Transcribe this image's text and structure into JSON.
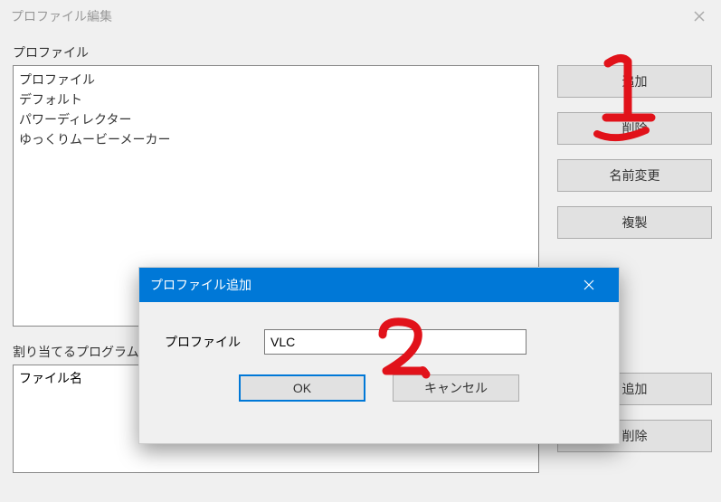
{
  "window": {
    "title": "プロファイル編集"
  },
  "profiles": {
    "label": "プロファイル",
    "items": [
      "プロファイル",
      "デフォルト",
      "パワーディレクター",
      "ゆっくりムービーメーカー"
    ],
    "buttons": {
      "add": "追加",
      "remove": "削除",
      "rename": "名前変更",
      "duplicate": "複製"
    }
  },
  "assigned": {
    "label": "割り当てるプログラム",
    "header": "ファイル名",
    "buttons": {
      "add": "追加",
      "remove": "削除"
    }
  },
  "dialog": {
    "title": "プロファイル追加",
    "field_label": "プロファイル",
    "value": "VLC",
    "ok": "OK",
    "cancel": "キャンセル"
  },
  "annotations": {
    "one": "1",
    "two": "2"
  }
}
